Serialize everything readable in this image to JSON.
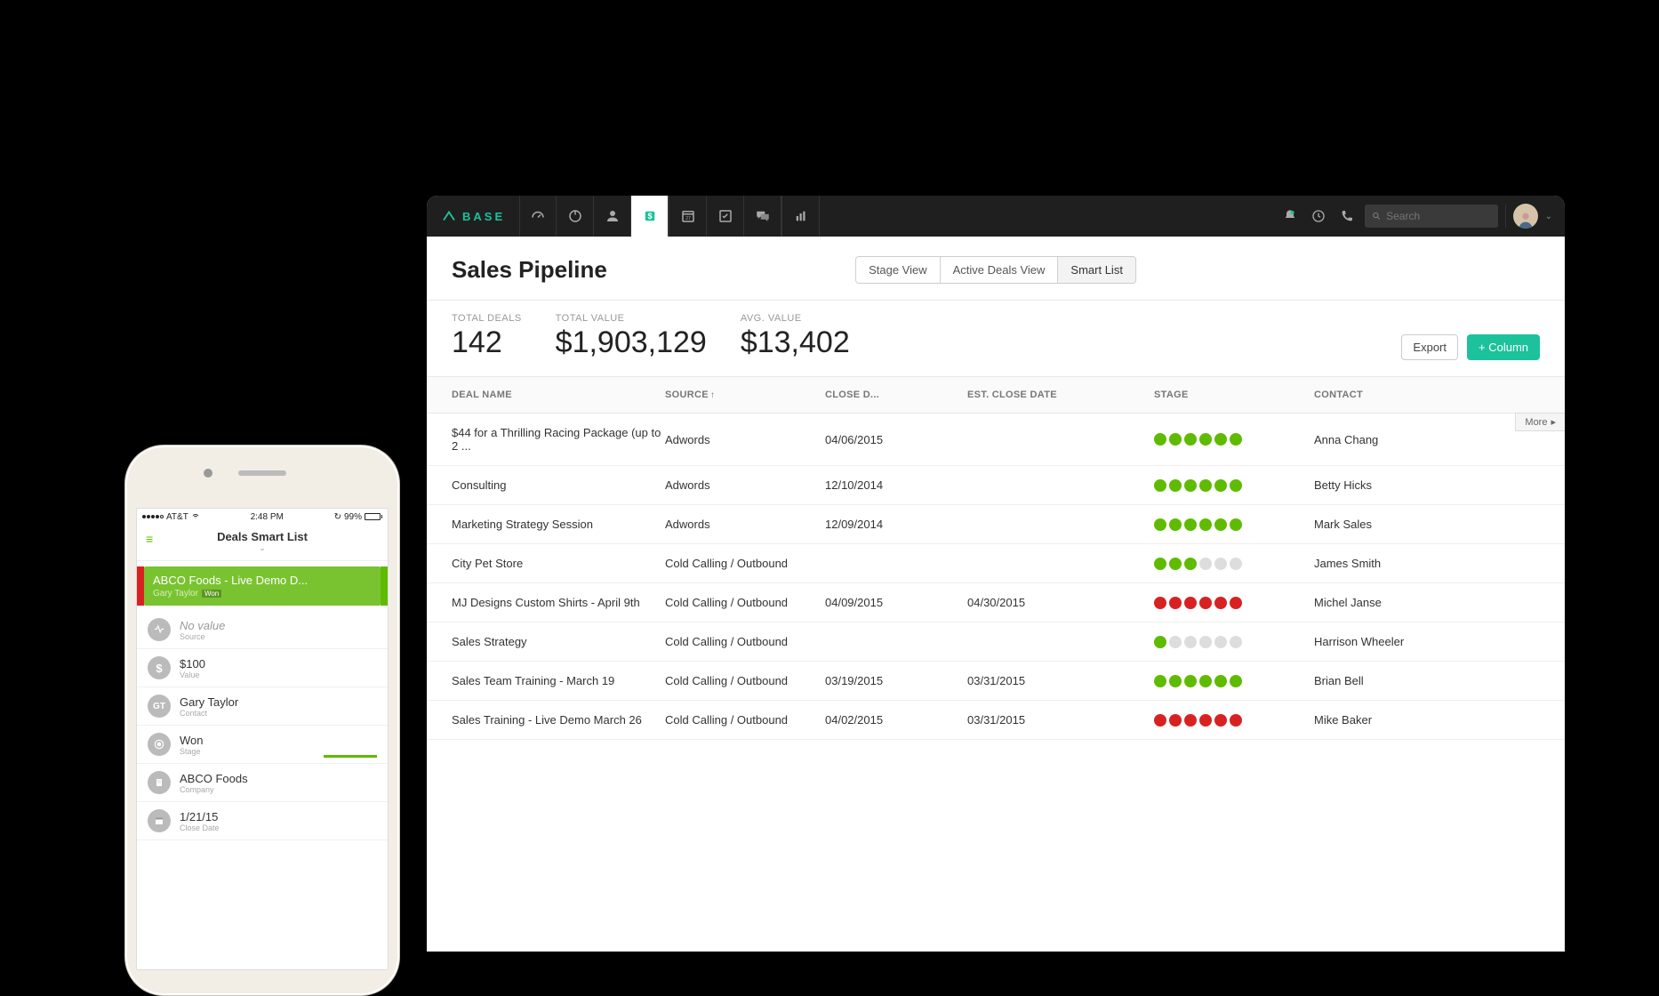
{
  "brand": "BASE",
  "search_placeholder": "Search",
  "page_title": "Sales Pipeline",
  "views": [
    "Stage View",
    "Active Deals View",
    "Smart List"
  ],
  "active_view_index": 2,
  "stats": [
    {
      "label": "TOTAL DEALS",
      "value": "142"
    },
    {
      "label": "TOTAL VALUE",
      "value": "$1,903,129"
    },
    {
      "label": "AVG. VALUE",
      "value": "$13,402"
    }
  ],
  "export_label": "Export",
  "column_label": "+ Column",
  "more_label": "More",
  "columns": {
    "name": "DEAL NAME",
    "source": "SOURCE",
    "close": "CLOSE D...",
    "est": "EST. CLOSE DATE",
    "stage": "STAGE",
    "contact": "CONTACT"
  },
  "deals": [
    {
      "name": "$44 for a Thrilling Racing Package (up to 2 ...",
      "source": "Adwords",
      "close": "04/06/2015",
      "est": "",
      "stage": [
        "green",
        "green",
        "green",
        "green",
        "green",
        "green"
      ],
      "contact": "Anna Chang"
    },
    {
      "name": "Consulting",
      "source": "Adwords",
      "close": "12/10/2014",
      "est": "",
      "stage": [
        "green",
        "green",
        "green",
        "green",
        "green",
        "green"
      ],
      "contact": "Betty Hicks"
    },
    {
      "name": "Marketing Strategy Session",
      "source": "Adwords",
      "close": "12/09/2014",
      "est": "",
      "stage": [
        "green",
        "green",
        "green",
        "green",
        "green",
        "green"
      ],
      "contact": "Mark Sales"
    },
    {
      "name": "City Pet Store",
      "source": "Cold Calling / Outbound",
      "close": "",
      "est": "",
      "stage": [
        "green",
        "green",
        "green",
        "grey",
        "grey",
        "grey"
      ],
      "contact": "James Smith"
    },
    {
      "name": "MJ Designs Custom Shirts - April 9th",
      "source": "Cold Calling / Outbound",
      "close": "04/09/2015",
      "est": "04/30/2015",
      "stage": [
        "red",
        "red",
        "red",
        "red",
        "red",
        "red"
      ],
      "contact": "Michel Janse"
    },
    {
      "name": "Sales Strategy",
      "source": "Cold Calling / Outbound",
      "close": "",
      "est": "",
      "stage": [
        "green",
        "grey",
        "grey",
        "grey",
        "grey",
        "grey"
      ],
      "contact": "Harrison Wheeler"
    },
    {
      "name": "Sales Team Training - March 19",
      "source": "Cold Calling / Outbound",
      "close": "03/19/2015",
      "est": "03/31/2015",
      "stage": [
        "green",
        "green",
        "green",
        "green",
        "green",
        "green"
      ],
      "contact": "Brian Bell"
    },
    {
      "name": "Sales Training - Live Demo March 26",
      "source": "Cold Calling / Outbound",
      "close": "04/02/2015",
      "est": "03/31/2015",
      "stage": [
        "red",
        "red",
        "red",
        "red",
        "red",
        "red"
      ],
      "contact": "Mike Baker"
    }
  ],
  "phone": {
    "carrier": "AT&T",
    "time": "2:48 PM",
    "battery": "99%",
    "title": "Deals Smart List",
    "card_title": "ABCO Foods - Live Demo D...",
    "card_owner": "Gary Taylor",
    "card_badge": "Won",
    "details": [
      {
        "icon": "source",
        "value": "No value",
        "label": "Source",
        "novalue": true
      },
      {
        "icon": "dollar",
        "value": "$100",
        "label": "Value"
      },
      {
        "icon": "GT",
        "value": "Gary Taylor",
        "label": "Contact"
      },
      {
        "icon": "stage",
        "value": "Won",
        "label": "Stage",
        "stage": true
      },
      {
        "icon": "building",
        "value": "ABCO Foods",
        "label": "Company"
      },
      {
        "icon": "calendar",
        "value": "1/21/15",
        "label": "Close Date"
      }
    ]
  }
}
